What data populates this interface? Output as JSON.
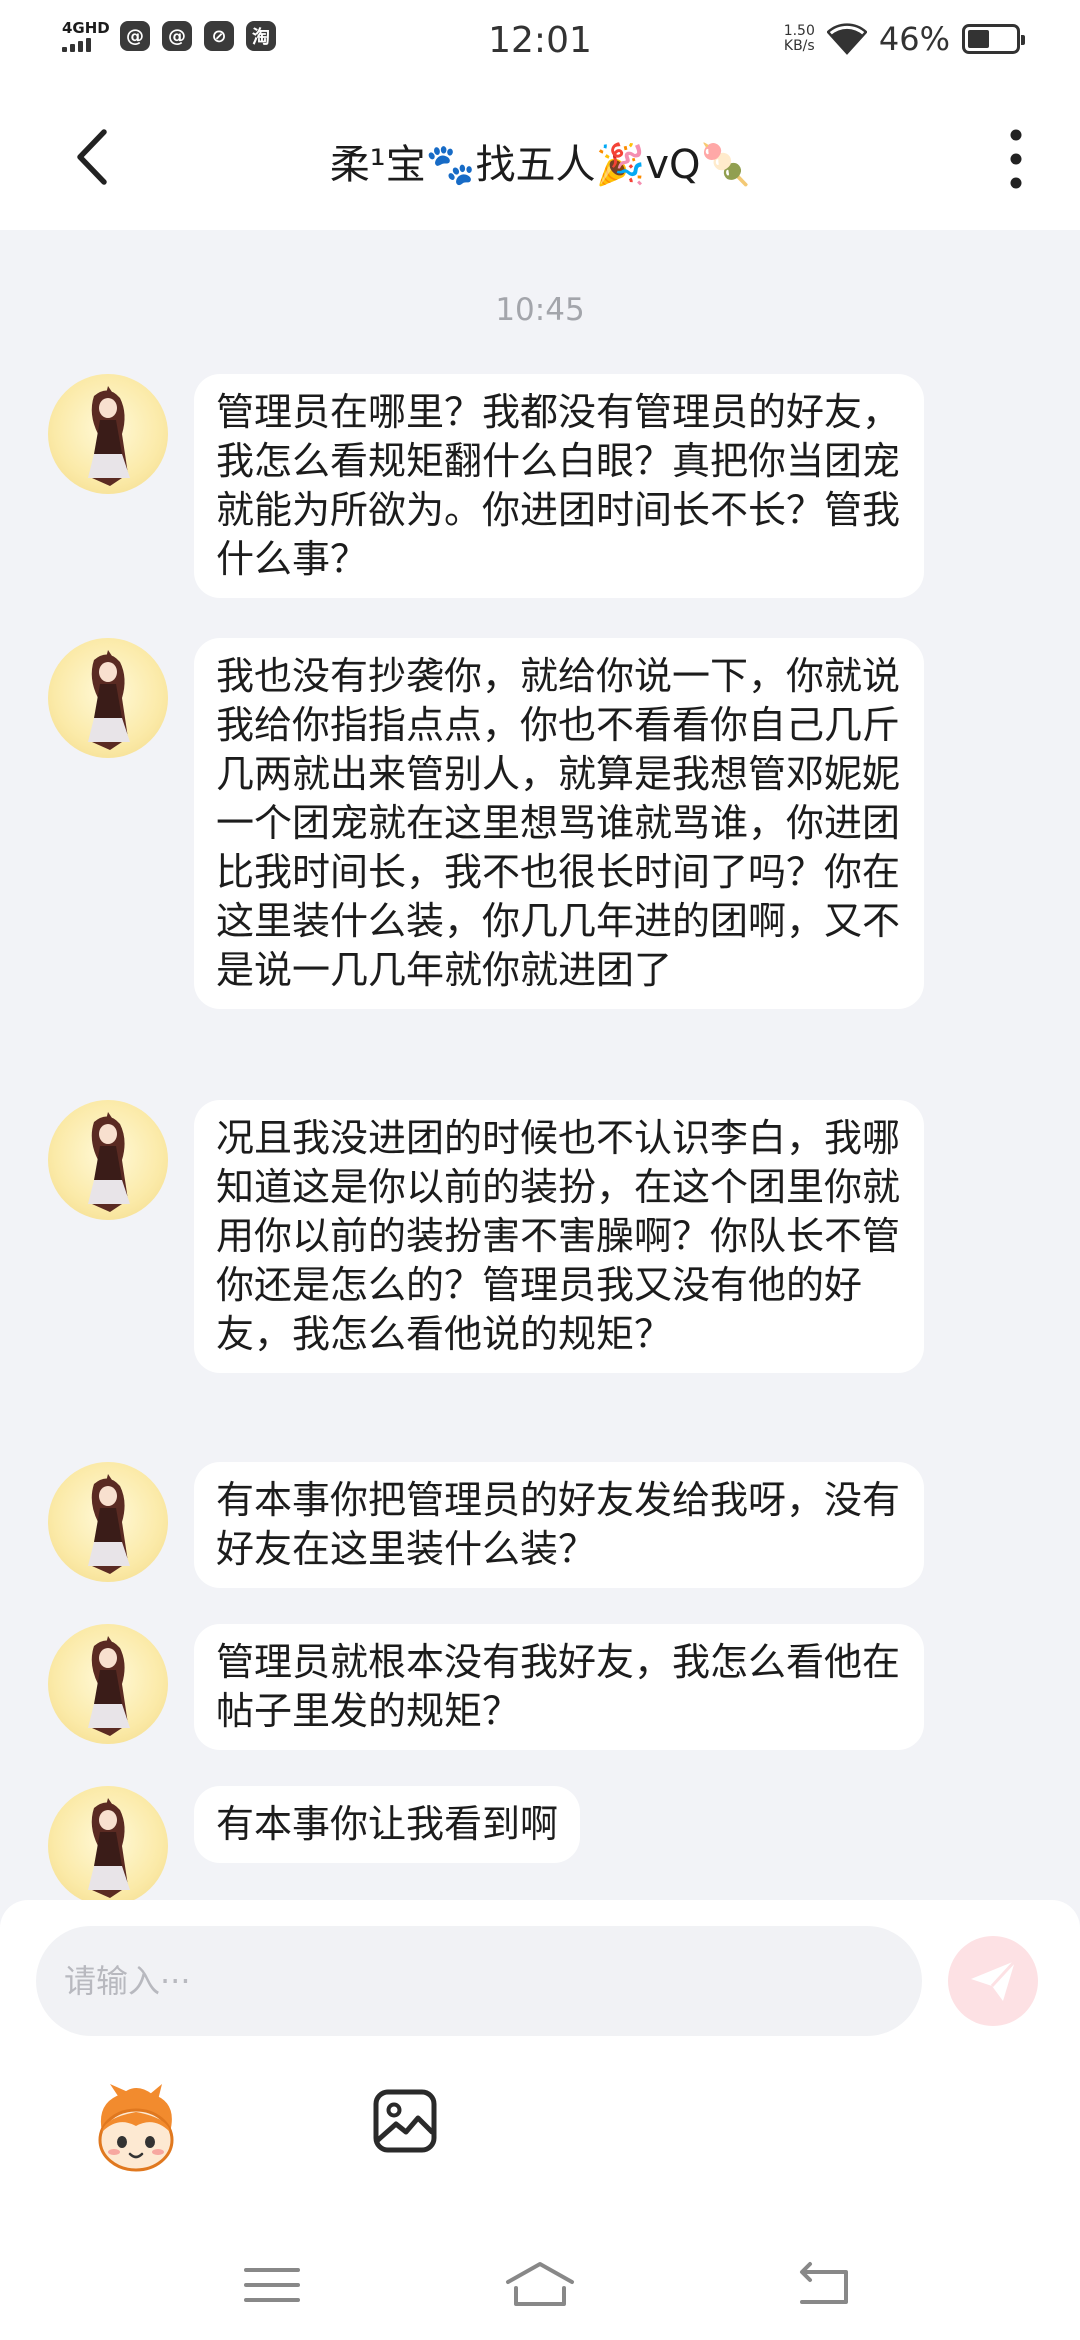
{
  "status_bar": {
    "network": "4GHD",
    "app_icons": [
      "@",
      "@",
      "⊘",
      "淘"
    ],
    "time": "12:01",
    "speed_value": "1.50",
    "speed_unit": "KB/s",
    "battery_percent": "46%",
    "battery_level": 0.46
  },
  "header": {
    "title": "柔¹宝🐾找五人🎉vQ🍡"
  },
  "chat": {
    "timestamp": "10:45",
    "messages": [
      {
        "text": "管理员在哪里？我都没有管理员的好友，我怎么看规矩翻什么白眼？真把你当团宠就能为所欲为。你进团时间长不长？管我什么事？"
      },
      {
        "text": "我也没有抄袭你，就给你说一下，你就说我给你指指点点，你也不看看你自己几斤几两就出来管别人，就算是我想管邓妮妮一个团宠就在这里想骂谁就骂谁，你进团比我时间长，我不也很长时间了吗？你在这里装什么装，你几几年进的团啊，又不是说一几几年就你就进团了"
      },
      {
        "text": "况且我没进团的时候也不认识李白，我哪知道这是你以前的装扮，在这个团里你就用你以前的装扮害不害臊啊？你队长不管你还是怎么的？管理员我又没有他的好友，我怎么看他说的规矩？"
      },
      {
        "text": "有本事你把管理员的好友发给我呀，没有好友在这里装什么装？"
      },
      {
        "text": "管理员就根本没有我好友，我怎么看他在帖子里发的规矩？"
      },
      {
        "text": "有本事你让我看到啊"
      }
    ]
  },
  "input": {
    "placeholder": "请输入···",
    "value": ""
  },
  "icons": {
    "back": "chevron-left-icon",
    "more": "more-vertical-icon",
    "send": "send-icon",
    "emoji": "emoji-mascot-icon",
    "image": "image-icon",
    "nav_menu": "menu-icon",
    "nav_home": "home-icon",
    "nav_back": "back-icon"
  },
  "colors": {
    "background": "#f2f3f7",
    "bubble": "#ffffff",
    "send_button": "#fde1e4",
    "send_arrow": "#ffffff",
    "timestamp": "#a3a5ab"
  }
}
